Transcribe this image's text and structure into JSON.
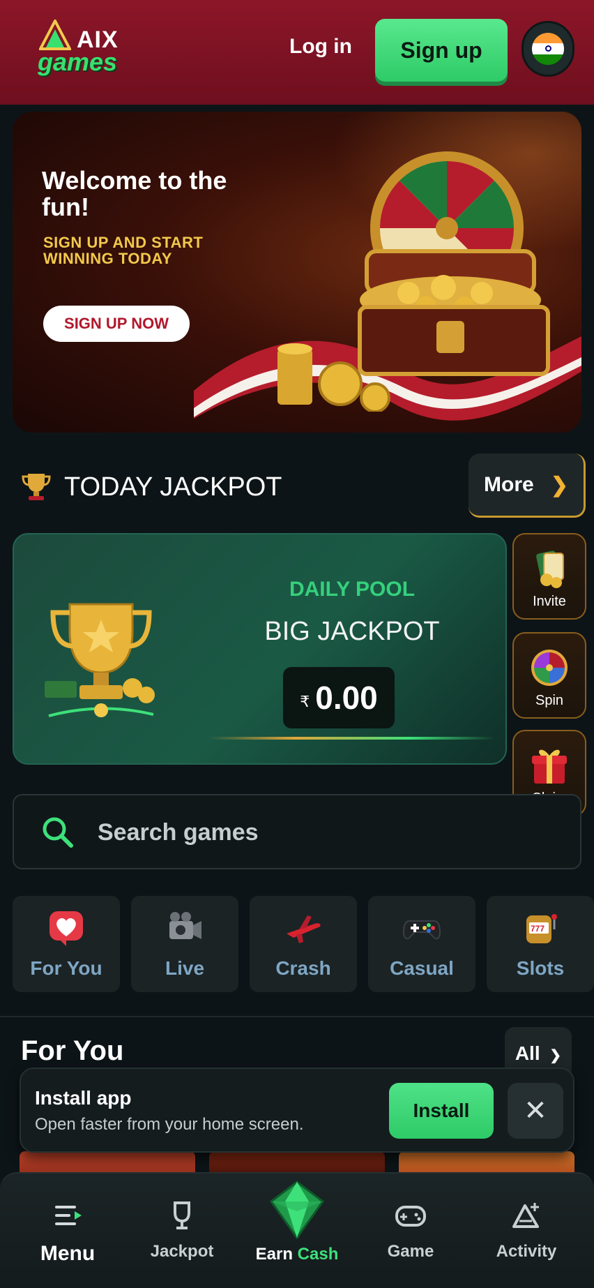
{
  "header": {
    "logo_top": "AIX",
    "logo_bottom": "games",
    "login_label": "Log in",
    "signup_label": "Sign up",
    "flag_icon": "india-flag-icon"
  },
  "banner": {
    "title": "Welcome to the fun!",
    "subtitle": "SIGN UP AND START WINNING TODAY",
    "cta_label": "SIGN UP NOW"
  },
  "jackpot": {
    "section_title": "TODAY JACKPOT",
    "more_label": "More",
    "pool_label": "DAILY POOL",
    "pool_subtitle": "BIG JACKPOT",
    "currency": "₹",
    "amount": "0.00"
  },
  "side_actions": [
    {
      "label": "Invite",
      "icon": "cards-icon"
    },
    {
      "label": "Spin",
      "icon": "wheel-icon"
    },
    {
      "label": "Claim",
      "icon": "gift-icon"
    }
  ],
  "search": {
    "placeholder": "Search games"
  },
  "categories": [
    {
      "label": "For You",
      "icon": "heart-icon"
    },
    {
      "label": "Live",
      "icon": "camera-icon"
    },
    {
      "label": "Crash",
      "icon": "plane-icon"
    },
    {
      "label": "Casual",
      "icon": "gamepad-icon"
    },
    {
      "label": "Slots",
      "icon": "slot-machine-icon"
    }
  ],
  "for_you": {
    "title": "For You",
    "all_label": "All"
  },
  "install_toast": {
    "title": "Install app",
    "subtitle": "Open faster from your home screen.",
    "install_label": "Install"
  },
  "nav": {
    "items": [
      {
        "label": "Menu",
        "icon": "menu-icon"
      },
      {
        "label": "Jackpot",
        "icon": "trophy-icon"
      },
      {
        "label": "Game",
        "icon": "gamepad-icon"
      },
      {
        "label": "Activity",
        "icon": "activity-icon"
      }
    ],
    "earn_prefix": "Earn",
    "earn_suffix": "Cash"
  },
  "colors": {
    "header_bg": "#8c1628",
    "accent_green": "#3ee07a",
    "gold": "#f2c94c",
    "page_bg": "#0d1417"
  }
}
